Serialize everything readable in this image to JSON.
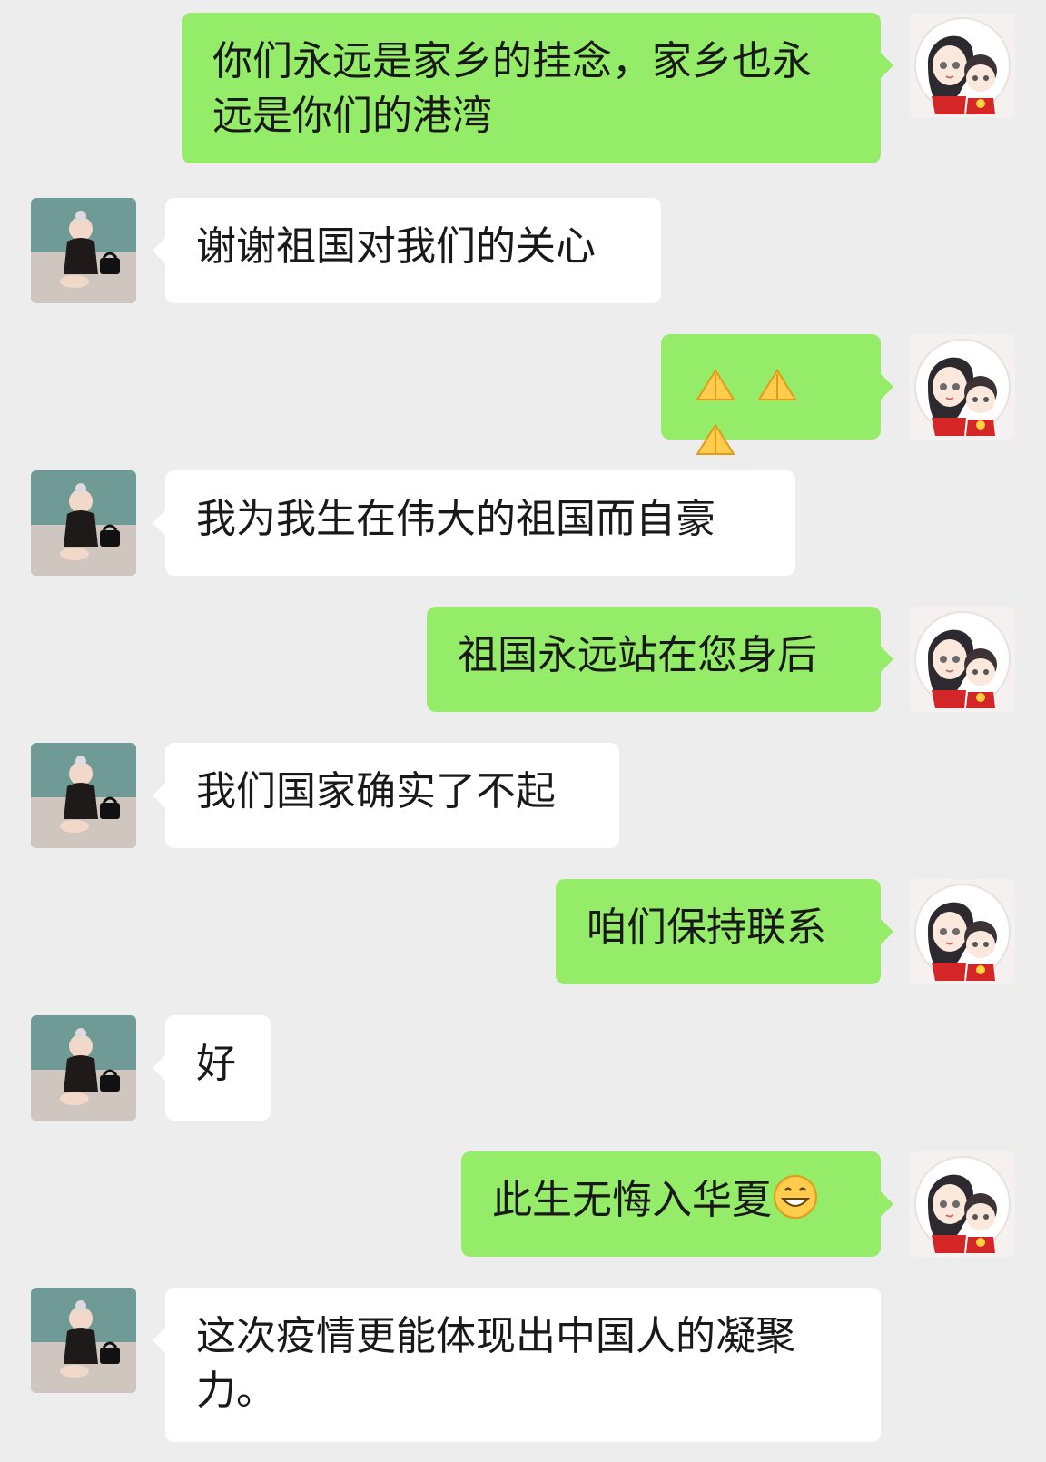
{
  "messages": [
    {
      "side": "out",
      "text": "你们永远是家乡的挂念，家乡也永远是你们的港湾"
    },
    {
      "side": "in",
      "text": "谢谢祖国对我们的关心"
    },
    {
      "side": "out",
      "text": "",
      "icon": "folded-hands-icon",
      "icon_count": 3
    },
    {
      "side": "in",
      "text": "我为我生在伟大的祖国而自豪"
    },
    {
      "side": "out",
      "text": "祖国永远站在您身后"
    },
    {
      "side": "in",
      "text": "我们国家确实了不起"
    },
    {
      "side": "out",
      "text": "咱们保持联系"
    },
    {
      "side": "in",
      "text": "好"
    },
    {
      "side": "out",
      "text": "此生无悔入华夏",
      "icon": "grinning-face-icon"
    },
    {
      "side": "in",
      "text": "这次疫情更能体现出中国人的凝聚力。"
    }
  ],
  "colors": {
    "background": "#ededed",
    "outgoing_bubble": "#95ec69",
    "incoming_bubble": "#ffffff",
    "text": "#191919"
  }
}
